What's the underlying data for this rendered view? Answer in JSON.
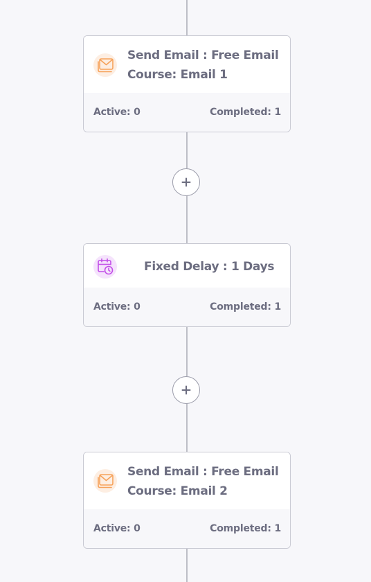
{
  "workflow": {
    "steps": [
      {
        "type": "send-email",
        "title_line1": "Send Email : Free Email",
        "title_line2": "Course: Email 1",
        "active": "Active: 0",
        "completed": "Completed: 1"
      },
      {
        "type": "fixed-delay",
        "title": "Fixed Delay : 1 Days",
        "active": "Active: 0",
        "completed": "Completed: 1"
      },
      {
        "type": "send-email",
        "title_line1": "Send Email : Free Email",
        "title_line2": "Course: Email 2",
        "active": "Active: 0",
        "completed": "Completed: 1"
      }
    ],
    "add_button_symbol": "+"
  },
  "colors": {
    "background": "#f7f7fa",
    "card_border": "#c9cad3",
    "text": "#6c6d80",
    "connector": "#bdbec6",
    "email_icon": "#f6a25a",
    "email_icon_bg": "#fdeee2",
    "delay_icon": "#c24de8",
    "delay_icon_bg": "#f5e3fc"
  },
  "icons": [
    "envelope-icon",
    "calendar-clock-icon",
    "plus-icon"
  ]
}
